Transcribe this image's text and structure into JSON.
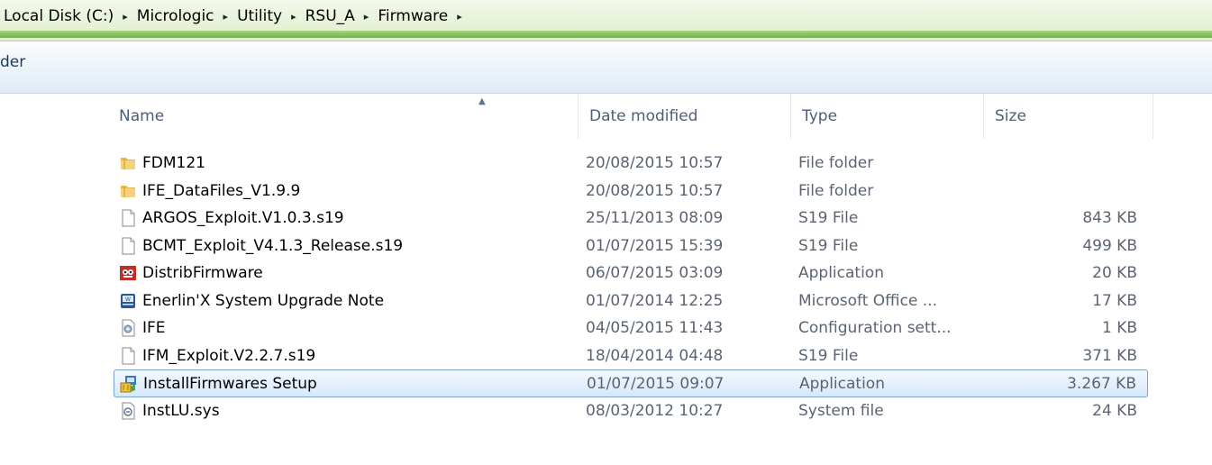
{
  "breadcrumb": {
    "items": [
      "Local Disk (C:)",
      "Micrologic",
      "Utility",
      "RSU_A",
      "Firmware"
    ],
    "separator": "▸"
  },
  "toolbar": {
    "partial_text": "der"
  },
  "columns": {
    "name": "Name",
    "date": "Date modified",
    "type": "Type",
    "size": "Size"
  },
  "files": [
    {
      "name": "FDM121",
      "date": "20/08/2015 10:57",
      "type": "File folder",
      "size": "",
      "icon": "folder-icon"
    },
    {
      "name": "IFE_DataFiles_V1.9.9",
      "date": "20/08/2015 10:57",
      "type": "File folder",
      "size": "",
      "icon": "folder-icon"
    },
    {
      "name": "ARGOS_Exploit.V1.0.3.s19",
      "date": "25/11/2013 08:09",
      "type": "S19 File",
      "size": "843 KB",
      "icon": "file-icon"
    },
    {
      "name": "BCMT_Exploit_V4.1.3_Release.s19",
      "date": "01/07/2015 15:39",
      "type": "S19 File",
      "size": "499 KB",
      "icon": "file-icon"
    },
    {
      "name": "DistribFirmware",
      "date": "06/07/2015 03:09",
      "type": "Application",
      "size": "20 KB",
      "icon": "application-icon"
    },
    {
      "name": "Enerlin'X  System Upgrade Note",
      "date": "01/07/2014 12:25",
      "type": "Microsoft Office ...",
      "size": "17 KB",
      "icon": "word-document-icon"
    },
    {
      "name": "IFE",
      "date": "04/05/2015 11:43",
      "type": "Configuration sett...",
      "size": "1 KB",
      "icon": "settings-file-icon"
    },
    {
      "name": "IFM_Exploit.V2.2.7.s19",
      "date": "18/04/2014 04:48",
      "type": "S19 File",
      "size": "371 KB",
      "icon": "file-icon"
    },
    {
      "name": "InstallFirmwares  Setup",
      "date": "01/07/2015 09:07",
      "type": "Application",
      "size": "3.267 KB",
      "icon": "installer-icon",
      "selected": true
    },
    {
      "name": "InstLU.sys",
      "date": "08/03/2012 10:27",
      "type": "System file",
      "size": "24 KB",
      "icon": "system-file-icon"
    }
  ],
  "colors": {
    "selection_border": "#7da2ce",
    "folder": "#e8b84a",
    "address_bar_green": "#6eb44a"
  }
}
